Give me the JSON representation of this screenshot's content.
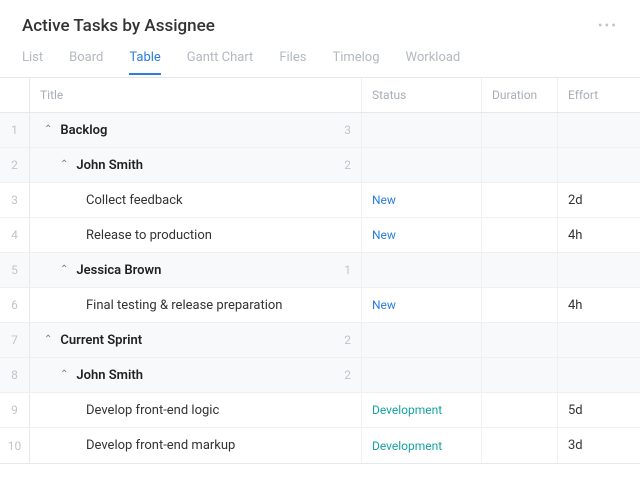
{
  "header": {
    "title": "Active Tasks by Assignee"
  },
  "tabs": [
    {
      "label": "List",
      "active": false
    },
    {
      "label": "Board",
      "active": false
    },
    {
      "label": "Table",
      "active": true
    },
    {
      "label": "Gantt Chart",
      "active": false
    },
    {
      "label": "Files",
      "active": false
    },
    {
      "label": "Timelog",
      "active": false
    },
    {
      "label": "Workload",
      "active": false
    }
  ],
  "columns": {
    "title": "Title",
    "status": "Status",
    "duration": "Duration",
    "effort": "Effort"
  },
  "statuses": {
    "new": "New",
    "development": "Development"
  },
  "rows": [
    {
      "num": "1",
      "type": "group0",
      "title": "Backlog",
      "count": "3",
      "shaded": true
    },
    {
      "num": "2",
      "type": "group1",
      "title": "John Smith",
      "count": "2",
      "shaded": true
    },
    {
      "num": "3",
      "type": "task",
      "title": "Collect feedback",
      "status": "new",
      "effort": "2d"
    },
    {
      "num": "4",
      "type": "task",
      "title": "Release to production",
      "status": "new",
      "effort": "4h"
    },
    {
      "num": "5",
      "type": "group1",
      "title": "Jessica Brown",
      "count": "1",
      "shaded": true
    },
    {
      "num": "6",
      "type": "task",
      "title": "Final testing & release preparation",
      "status": "new",
      "effort": "4h"
    },
    {
      "num": "7",
      "type": "group0",
      "title": "Current Sprint",
      "count": "2",
      "shaded": true
    },
    {
      "num": "8",
      "type": "group1",
      "title": "John Smith",
      "count": "2",
      "shaded": true
    },
    {
      "num": "9",
      "type": "task",
      "title": "Develop front-end logic",
      "status": "development",
      "effort": "5d"
    },
    {
      "num": "10",
      "type": "task",
      "title": "Develop front-end markup",
      "status": "development",
      "effort": "3d"
    }
  ]
}
